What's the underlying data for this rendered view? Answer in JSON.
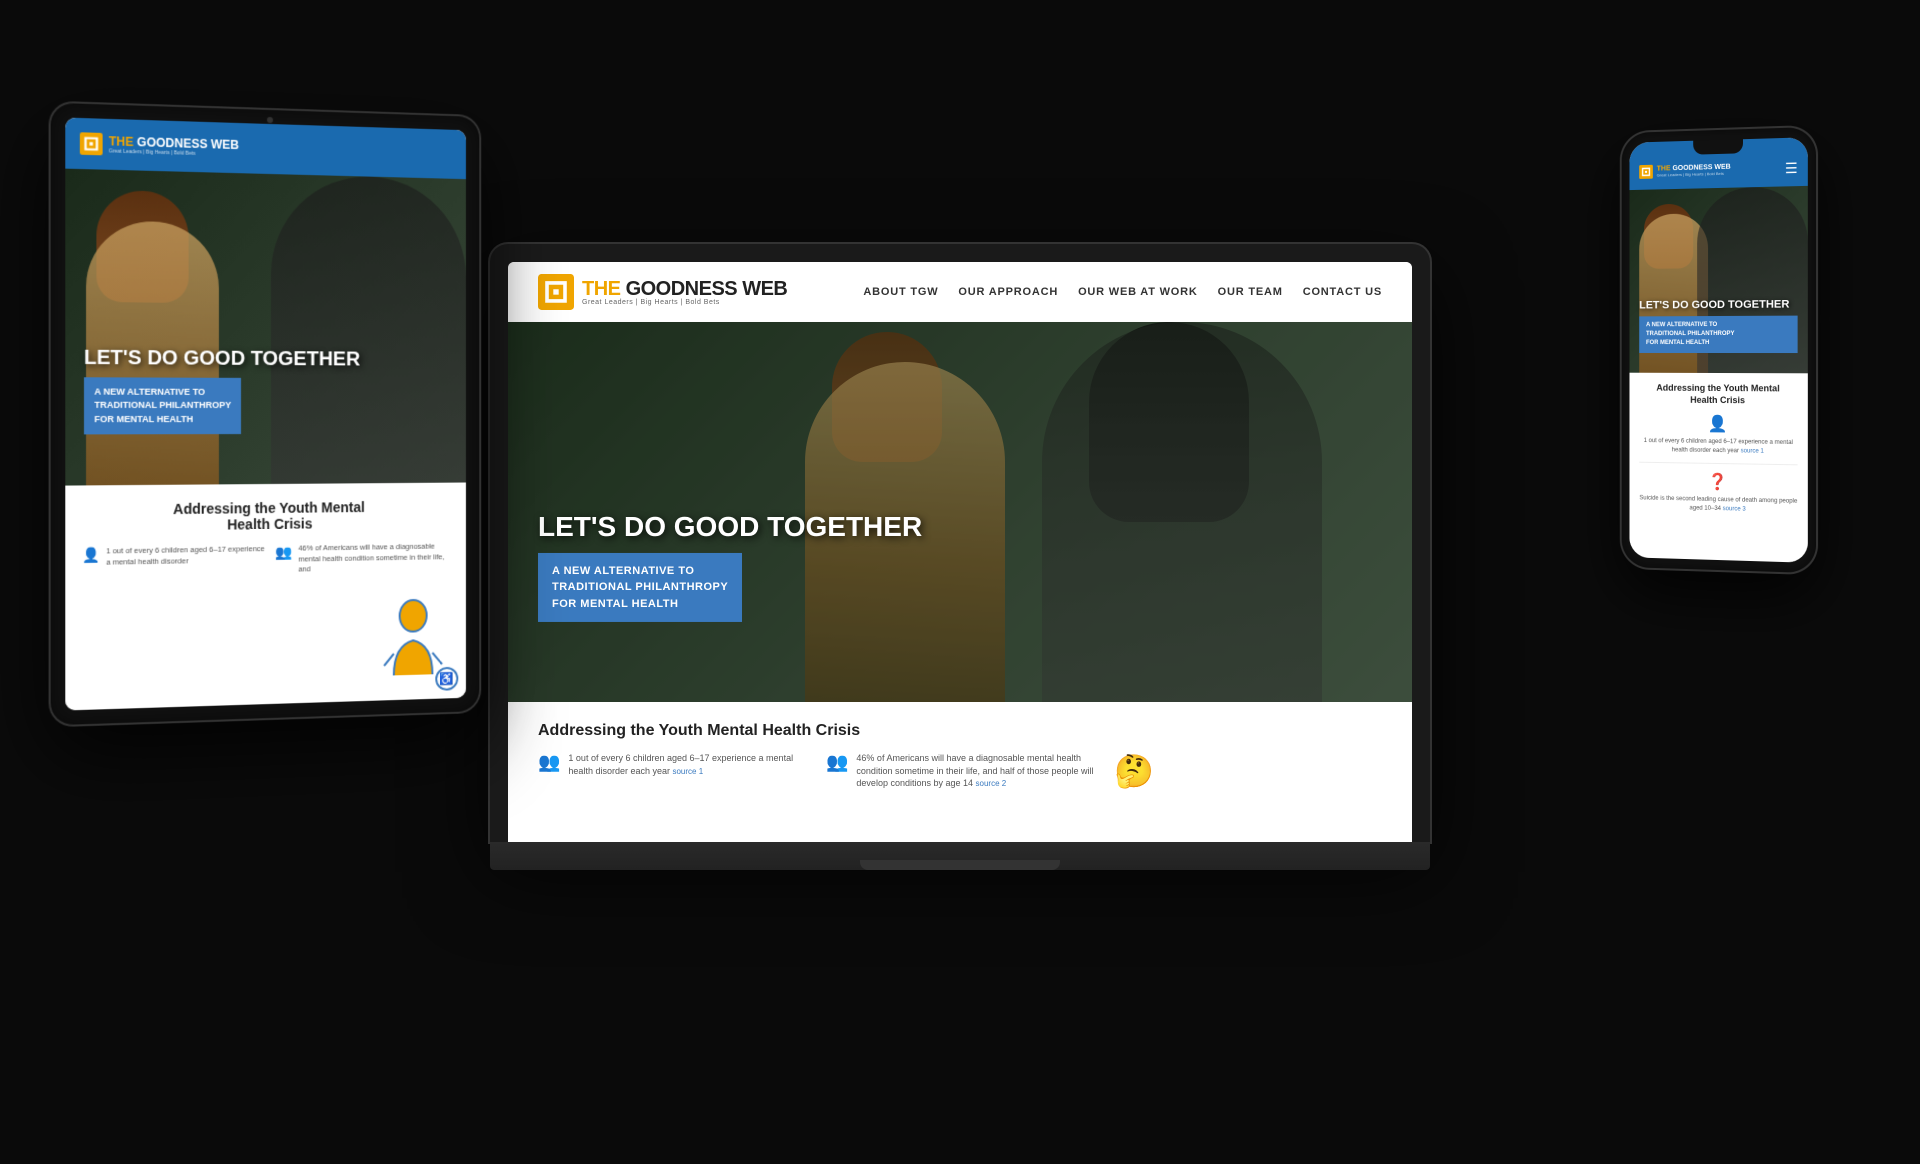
{
  "site": {
    "name": "THE GOODNESS WEB",
    "name_highlight": "THE",
    "tagline": "Great Leaders | Big Hearts | Bold Bets",
    "nav": {
      "items": [
        {
          "label": "ABOUT TGW"
        },
        {
          "label": "OUR APPROACH"
        },
        {
          "label": "OUR WEB AT WORK"
        },
        {
          "label": "OUR TEAM"
        },
        {
          "label": "CONTACT US"
        }
      ]
    },
    "hero": {
      "headline": "LET'S DO GOOD TOGETHER",
      "subtext_line1": "A NEW ALTERNATIVE TO",
      "subtext_line2": "TRADITIONAL PHILANTHROPY",
      "subtext_line3": "FOR MENTAL HEALTH"
    },
    "section": {
      "title": "Addressing the Youth Mental Health Crisis",
      "stat1": {
        "icon": "👥",
        "text": "1 out of every 6 children aged 6–17 experience a mental health disorder each year",
        "source": "source 1"
      },
      "stat2": {
        "icon": "👥",
        "text": "46% of Americans will have a diagnosable mental health condition sometime in their life, and half of those people will develop conditions by age 14",
        "source": "source 2"
      },
      "stat3": {
        "icon": "?",
        "text": "Suicide is the second leading cause of death among people aged 10–34",
        "source": "source 3"
      }
    }
  }
}
